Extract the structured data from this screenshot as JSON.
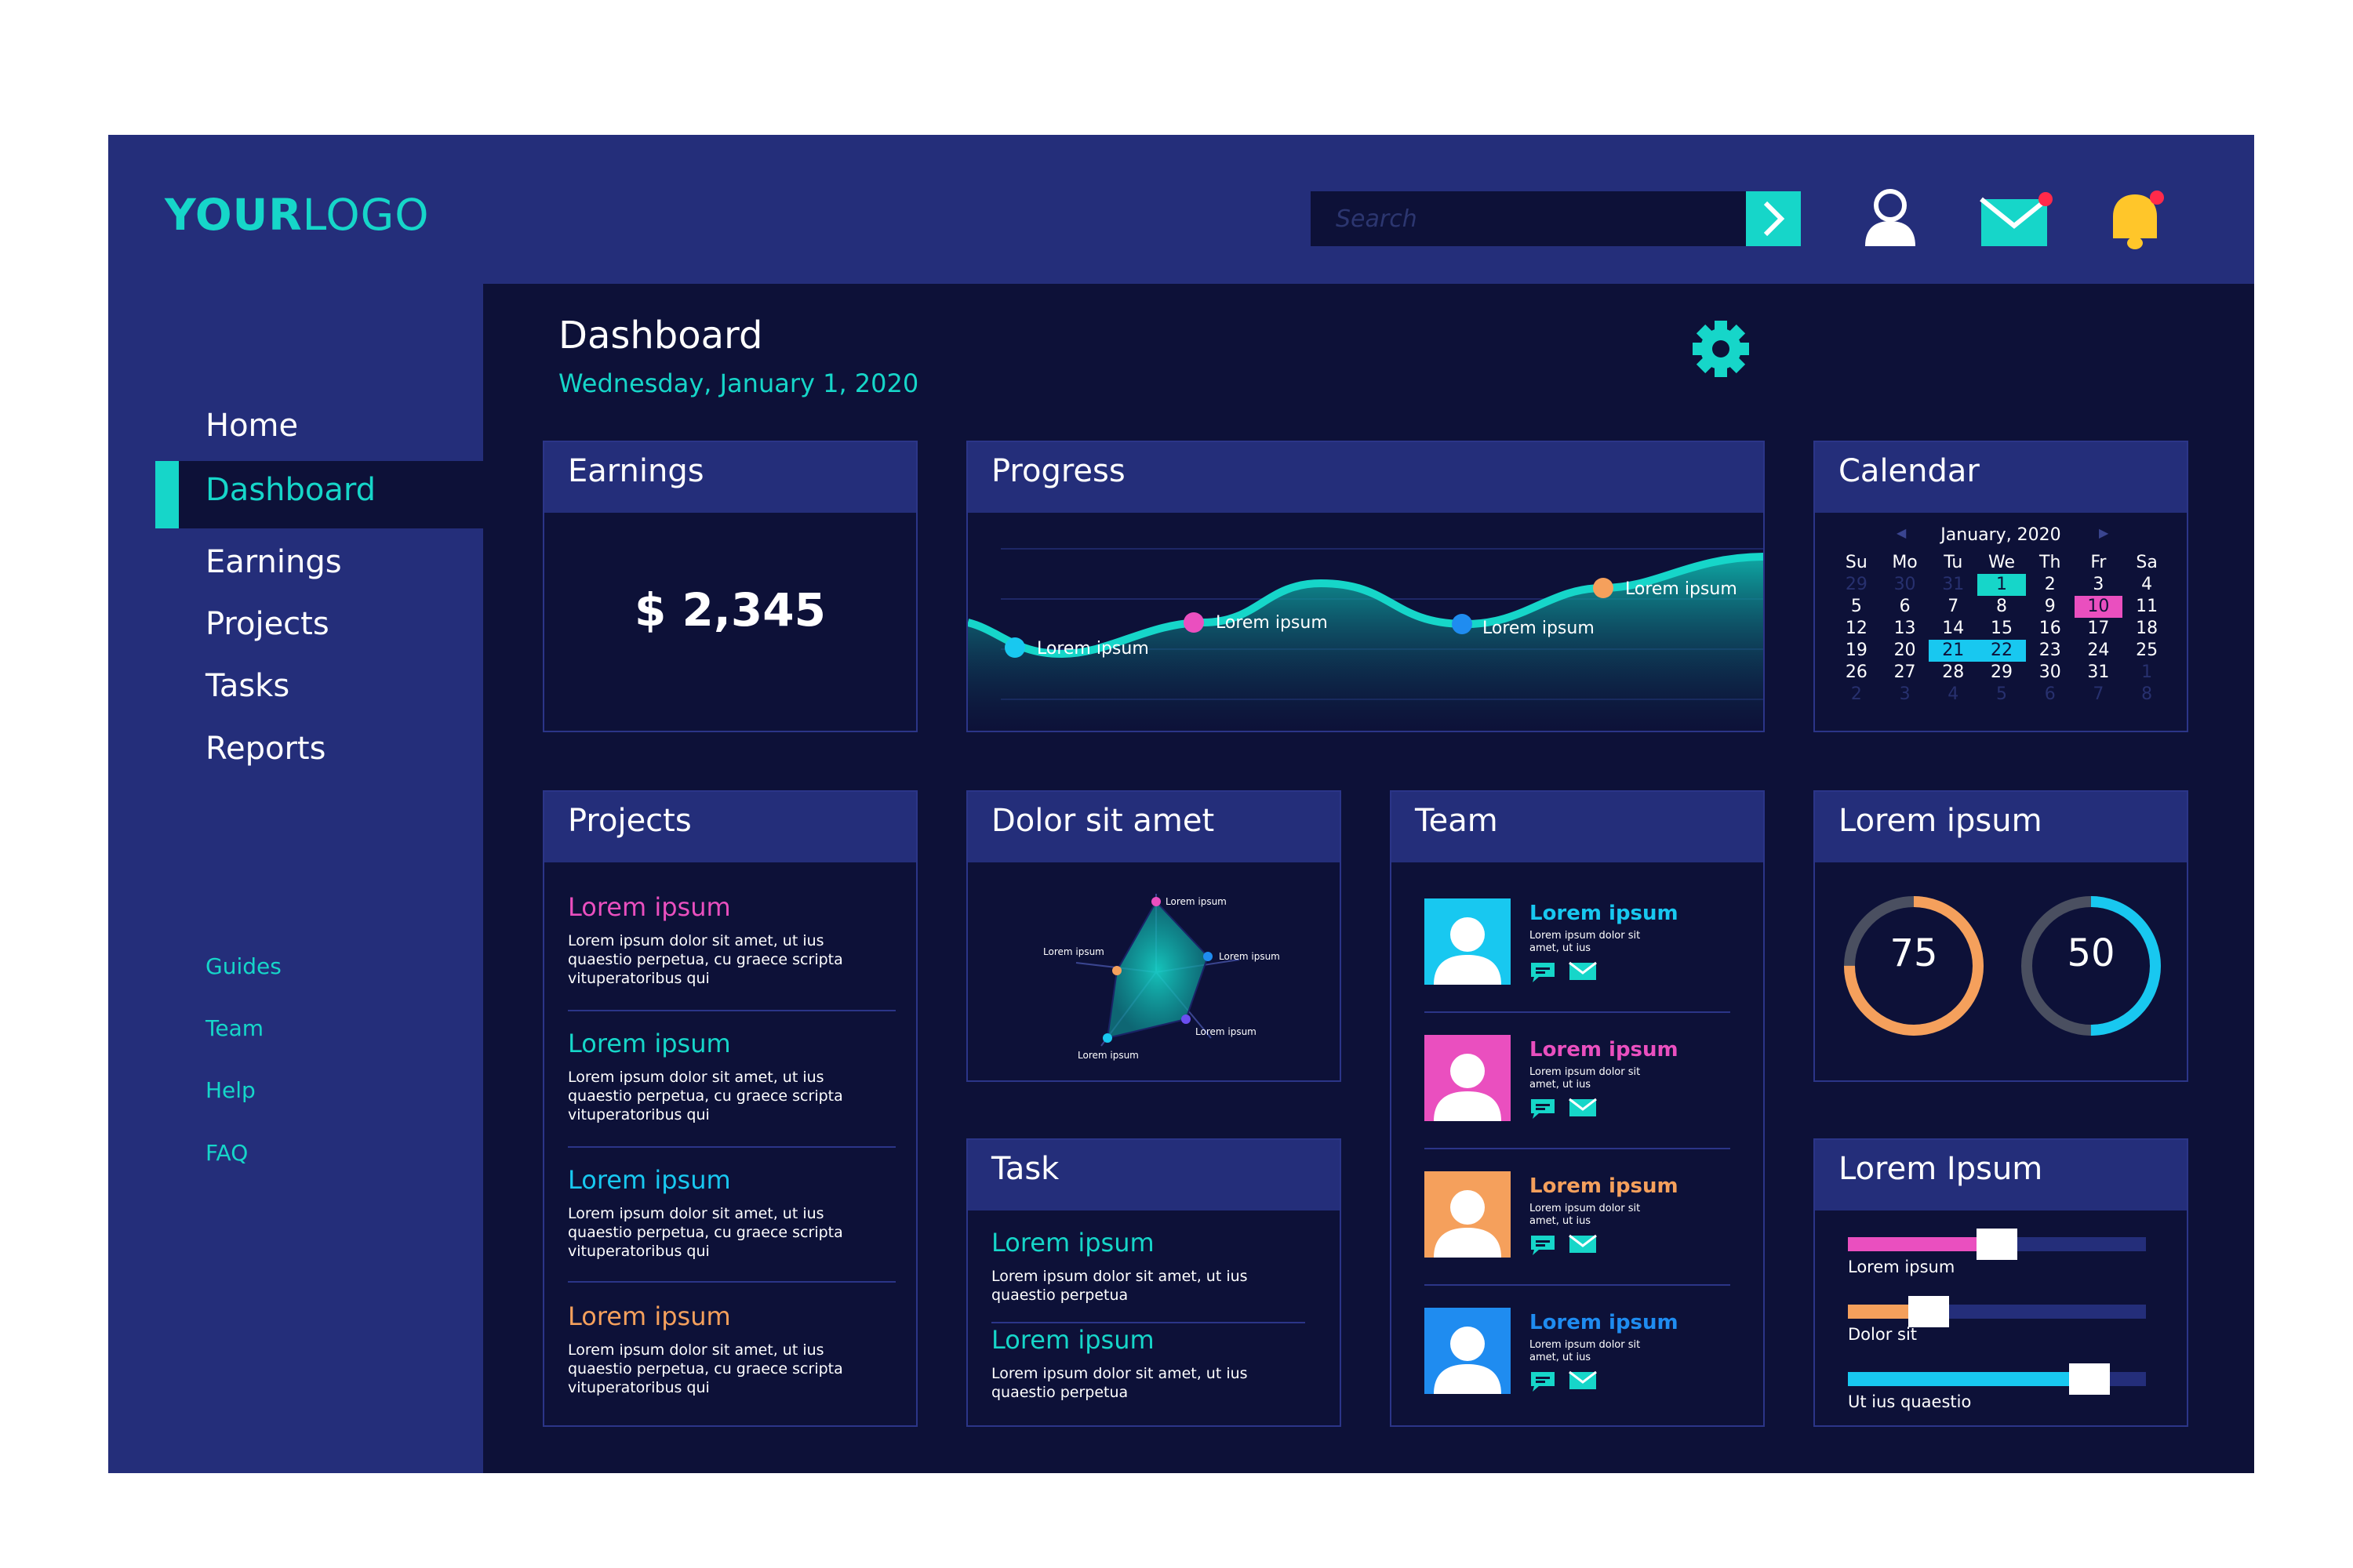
{
  "logo": {
    "bold": "YOUR",
    "light": "LOGO"
  },
  "search": {
    "placeholder": "Search"
  },
  "sidebar": {
    "items": [
      {
        "label": "Home"
      },
      {
        "label": "Dashboard",
        "active": true
      },
      {
        "label": "Earnings"
      },
      {
        "label": "Projects"
      },
      {
        "label": "Tasks"
      },
      {
        "label": "Reports"
      }
    ],
    "secondary": [
      {
        "label": "Guides"
      },
      {
        "label": "Team"
      },
      {
        "label": "Help"
      },
      {
        "label": "FAQ"
      }
    ]
  },
  "header": {
    "title": "Dashboard",
    "date": "Wednesday, January 1, 2020"
  },
  "earnings": {
    "title": "Earnings",
    "value": "$ 2,345"
  },
  "progress": {
    "title": "Progress",
    "points": [
      {
        "label": "Lorem ipsum",
        "color": "#18c8f0"
      },
      {
        "label": "Lorem ipsum",
        "color": "#ea4fbf"
      },
      {
        "label": "Lorem ipsum",
        "color": "#1f8cf0"
      },
      {
        "label": "Lorem ipsum",
        "color": "#f5a05c"
      }
    ]
  },
  "calendar": {
    "title": "Calendar",
    "month": "January, 2020",
    "dow": [
      "Su",
      "Mo",
      "Tu",
      "We",
      "Th",
      "Fr",
      "Sa"
    ],
    "days": [
      [
        "29",
        "30",
        "31",
        "1",
        "2",
        "3",
        "4"
      ],
      [
        "5",
        "6",
        "7",
        "8",
        "9",
        "10",
        "11"
      ],
      [
        "12",
        "13",
        "14",
        "15",
        "16",
        "17",
        "18"
      ],
      [
        "19",
        "20",
        "21",
        "22",
        "23",
        "24",
        "25"
      ],
      [
        "26",
        "27",
        "28",
        "29",
        "30",
        "31",
        "1"
      ],
      [
        "2",
        "3",
        "4",
        "5",
        "6",
        "7",
        "8"
      ]
    ],
    "highlights": {
      "today": "1",
      "marked": "10",
      "range": [
        "21",
        "22"
      ]
    }
  },
  "projects": {
    "title": "Projects",
    "items": [
      {
        "title": "Lorem ipsum",
        "desc": "Lorem ipsum dolor sit amet, ut ius quaestio perpetua, cu graece scripta vituperatoribus qui",
        "color": "#ea4fbf"
      },
      {
        "title": "Lorem ipsum",
        "desc": "Lorem ipsum dolor sit amet, ut ius quaestio perpetua, cu graece scripta vituperatoribus qui",
        "color": "#16d6c9"
      },
      {
        "title": "Lorem ipsum",
        "desc": "Lorem ipsum dolor sit amet, ut ius quaestio perpetua, cu graece scripta vituperatoribus qui",
        "color": "#18c8f0"
      },
      {
        "title": "Lorem ipsum",
        "desc": "Lorem ipsum dolor sit amet, ut ius quaestio perpetua, cu graece scripta vituperatoribus qui",
        "color": "#f5a05c"
      }
    ]
  },
  "radar": {
    "title": "Dolor sit amet",
    "points": [
      {
        "label": "Lorem ipsum",
        "color": "#ea4fbf"
      },
      {
        "label": "Lorem ipsum",
        "color": "#1f8cf0"
      },
      {
        "label": "Lorem ipsum",
        "color": "#6b4ef0"
      },
      {
        "label": "Lorem ipsum",
        "color": "#18c8f0"
      },
      {
        "label": "Lorem ipsum",
        "color": "#f5a05c"
      }
    ]
  },
  "task": {
    "title": "Task",
    "items": [
      {
        "title": "Lorem ipsum",
        "desc": "Lorem ipsum dolor sit amet, ut ius quaestio perpetua"
      },
      {
        "title": "Lorem ipsum",
        "desc": "Lorem ipsum dolor sit amet, ut ius quaestio perpetua"
      }
    ]
  },
  "team": {
    "title": "Team",
    "members": [
      {
        "name": "Lorem ipsum",
        "sub": "Lorem ipsum dolor sit amet, ut ius",
        "color": "#18c8f0",
        "avatar_bg": "#18c8f0"
      },
      {
        "name": "Lorem ipsum",
        "sub": "Lorem ipsum dolor sit amet, ut ius",
        "color": "#ea4fbf",
        "avatar_bg": "#ea4fbf"
      },
      {
        "name": "Lorem ipsum",
        "sub": "Lorem ipsum dolor sit amet, ut ius",
        "color": "#f5a05c",
        "avatar_bg": "#f5a05c"
      },
      {
        "name": "Lorem ipsum",
        "sub": "Lorem ipsum dolor sit amet, ut ius",
        "color": "#1f8cf0",
        "avatar_bg": "#1f8cf0"
      }
    ]
  },
  "gauges": {
    "title": "Lorem ipsum",
    "items": [
      {
        "value": "75",
        "percent": 75,
        "color": "#f5a05c"
      },
      {
        "value": "50",
        "percent": 50,
        "color": "#18c8f0"
      }
    ]
  },
  "sliders": {
    "title": "Lorem Ipsum",
    "items": [
      {
        "label": "Lorem ipsum",
        "value": 0.5,
        "color": "#ea4fbf"
      },
      {
        "label": "Dolor sit",
        "value": 0.27,
        "color": "#f5a05c"
      },
      {
        "label": "Ut ius quaestio",
        "value": 0.81,
        "color": "#18c8f0"
      }
    ]
  },
  "icons": {
    "search_submit": "chevron-right-icon",
    "user": "user-icon",
    "mail": "mail-icon",
    "bell": "bell-icon",
    "settings": "gear-icon"
  },
  "colors": {
    "frame": "#242e7a",
    "content": "#0d1138",
    "accent": "#16d6c9",
    "pink": "#ea4fbf",
    "orange": "#f5a05c",
    "cyan": "#18c8f0",
    "blue": "#1f8cf0"
  }
}
